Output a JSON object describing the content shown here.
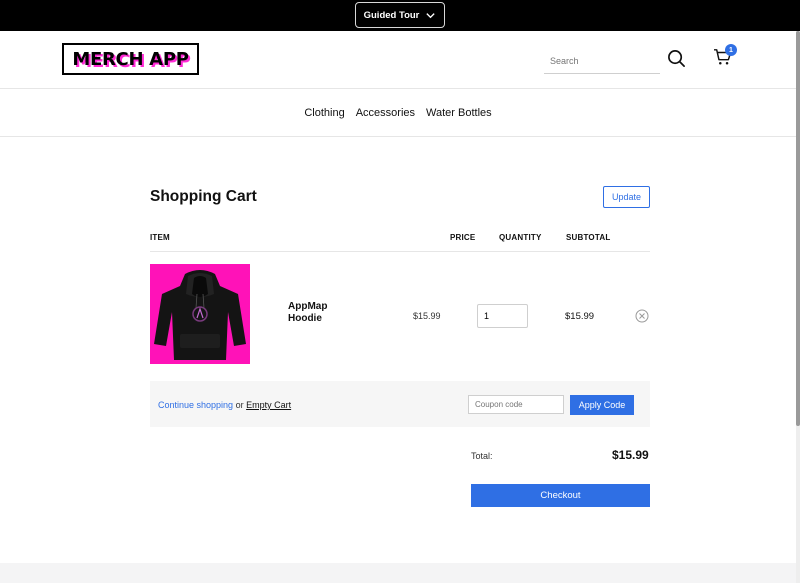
{
  "topbar": {
    "tour_label": "Guided Tour"
  },
  "header": {
    "logo_text": "MERCH APP",
    "search_placeholder": "Search",
    "cart_count": "1"
  },
  "nav": {
    "items": [
      "Clothing",
      "Accessories",
      "Water Bottles"
    ]
  },
  "cart": {
    "title": "Shopping Cart",
    "update_label": "Update",
    "columns": {
      "item": "ITEM",
      "price": "PRICE",
      "quantity": "QUANTITY",
      "subtotal": "SUBTOTAL"
    },
    "items": [
      {
        "name": "AppMap Hoodie",
        "price": "$15.99",
        "quantity": "1",
        "subtotal": "$15.99"
      }
    ],
    "continue_label": "Continue shopping",
    "or_text": "or",
    "empty_label": "Empty Cart",
    "coupon_placeholder": "Coupon code",
    "apply_label": "Apply Code",
    "total_label": "Total:",
    "total_value": "$15.99",
    "checkout_label": "Checkout"
  },
  "colors": {
    "accent": "#2f6fe4",
    "brand_pink": "#ff12b8",
    "topbar": "#000000"
  }
}
